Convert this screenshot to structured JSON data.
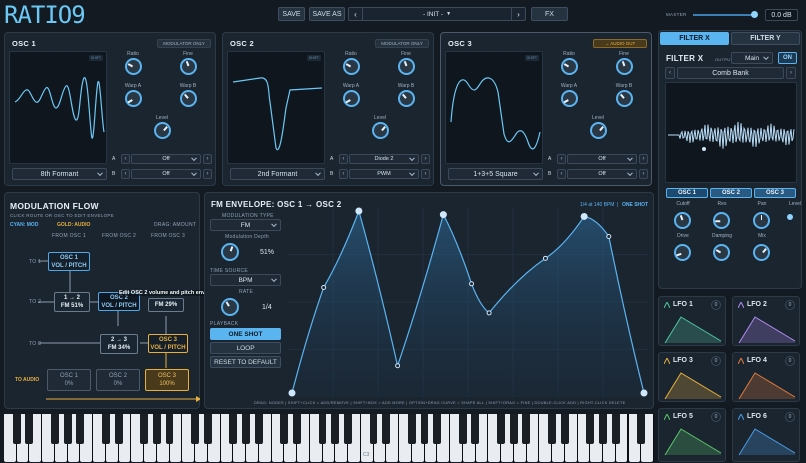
{
  "header": {
    "logo": "RATIO9",
    "save": "SAVE",
    "save_as": "SAVE AS",
    "preset": "- INIT -",
    "prev": "‹",
    "next": "›",
    "fx": "FX",
    "master_label": "MASTER",
    "master_value": "0.0 dB"
  },
  "osc1": {
    "title": "OSC 1",
    "badge": "MODULATOR ONLY",
    "mini": "SHIFT",
    "knobs": [
      "Ratio",
      "Fine",
      "Warp A",
      "Warp B",
      "Level"
    ],
    "shape": "8th Formant",
    "warpA_label": "A",
    "warpB_label": "B",
    "warpA": "Off",
    "warpB": "Off"
  },
  "osc2": {
    "title": "OSC 2",
    "badge": "MODULATOR ONLY",
    "mini": "SHIFT",
    "knobs": [
      "Ratio",
      "Fine",
      "Warp A",
      "Warp B",
      "Level"
    ],
    "shape": "2nd Formant",
    "warpA_label": "A",
    "warpB_label": "B",
    "warpA": "Diode 2",
    "warpB": "PWM"
  },
  "osc3": {
    "title": "OSC 3",
    "badge": "→ AUDIO OUT",
    "mini": "SHIFT",
    "knobs": [
      "Ratio",
      "Fine",
      "Warp A",
      "Warp B",
      "Level"
    ],
    "shape": "1+3+5 Square",
    "warpA_label": "A",
    "warpB_label": "B",
    "warpA": "Off",
    "warpB": "Off"
  },
  "filter": {
    "tab_x": "FILTER X",
    "tab_y": "FILTER Y",
    "title": "FILTER X",
    "output_label": "OUTPUT",
    "output": "Main",
    "on": "ON",
    "type": "Comb Bank",
    "src": [
      "OSC 1",
      "OSC 2",
      "OSC 3"
    ],
    "knobs": [
      "Cutoff",
      "Res",
      "Pan",
      "Level",
      "Drive",
      "Damping",
      "Mix"
    ]
  },
  "modflow": {
    "title": "MODULATION FLOW",
    "sub": "CLICK ROUTE OR OSC TO EDIT ENVELOPE",
    "legend_cyan": "CYAN: MOD",
    "legend_gold": "GOLD: AUDIO",
    "drag": "DRAG: AMOUNT",
    "from1": "FROM OSC 1",
    "from2": "FROM OSC 2",
    "from3": "FROM OSC 3",
    "to1": "TO 1",
    "to2": "TO 2",
    "to3": "TO 3",
    "to_audio": "TO AUDIO",
    "n_osc1_l1": "OSC 1",
    "n_osc1_l2": "VOL / PITCH",
    "n_12_l1": "1 → 2",
    "n_12_l2": "FM  51%",
    "n_osc2_l1": "OSC 2",
    "n_osc2_l2": "VOL / PITCH",
    "n_fm29": "FM  29%",
    "n_23_l1": "2 → 3",
    "n_23_l2": "FM  34%",
    "n_osc3_l1": "OSC 3",
    "n_osc3_l2": "VOL / PITCH",
    "tooltip": "Edit OSC 2 volume and pitch envelopes",
    "out1_l1": "OSC 1",
    "out1_l2": "0%",
    "out2_l1": "OSC 2",
    "out2_l2": "0%",
    "out3_l1": "OSC 3",
    "out3_l2": "100%"
  },
  "fmenv": {
    "title": "FM ENVELOPE: OSC 1 → OSC 2",
    "tempo": "1/4 at 140 BPM",
    "sep": "|",
    "mode": "ONE SHOT",
    "modtype_label": "MODULATION TYPE",
    "modtype": "FM",
    "depth_label": "Modulation Depth",
    "depth": "51%",
    "timesrc_label": "TIME SOURCE",
    "timesrc": "BPM",
    "rate_label": "RATE",
    "rate": "1/4",
    "playback_label": "PLAYBACK",
    "oneshot": "ONE SHOT",
    "loop": "LOOP",
    "reset": "RESET TO DEFAULT",
    "hint": "DRAG: NODES  |  SHIFT+CLICK = ADD/REMOVE  |  SHIFT+BOX = ADD MORE  |  OPTION+DRAG CURVE = SHAPE ALL  |  SHIFT+DRAG = FINE  |  DOUBLE-CLICK ADD  |  RIGHT-CLICK DELETE",
    "points": [
      [
        0,
        0
      ],
      [
        0.09,
        0.58
      ],
      [
        0.19,
        1.0
      ],
      [
        0.3,
        0.15
      ],
      [
        0.43,
        0.98
      ],
      [
        0.51,
        0.6
      ],
      [
        0.56,
        0.44
      ],
      [
        0.72,
        0.74
      ],
      [
        0.83,
        0.97
      ],
      [
        0.9,
        0.86
      ],
      [
        1.0,
        0.0
      ]
    ]
  },
  "lfos": [
    {
      "name": "LFO 1",
      "color": "#4ec9a0"
    },
    {
      "name": "LFO 2",
      "color": "#b08cf0"
    },
    {
      "name": "LFO 3",
      "color": "#e8b03c"
    },
    {
      "name": "LFO 4",
      "color": "#e07a3a"
    },
    {
      "name": "LFO 5",
      "color": "#5ac86a"
    },
    {
      "name": "LFO 6",
      "color": "#4a9ee8"
    }
  ],
  "lfo_zero": "0",
  "keyboard": {
    "c3": "C3"
  }
}
